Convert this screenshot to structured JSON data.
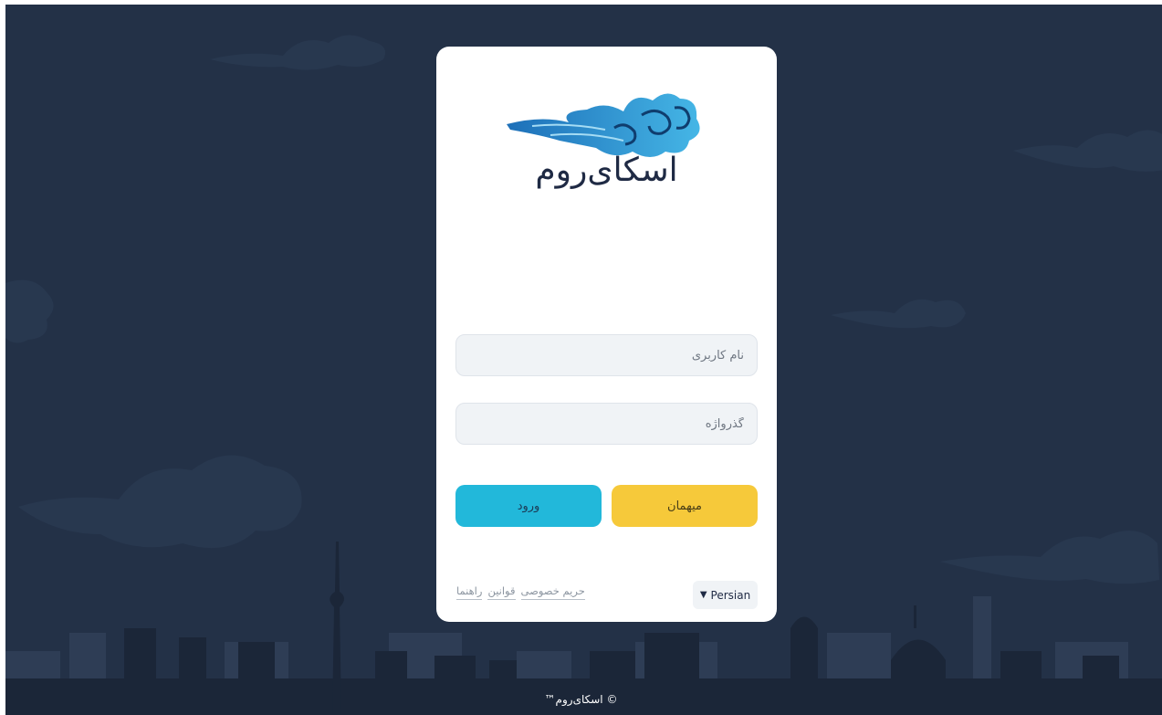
{
  "brand": {
    "name": "اسکای‌روم"
  },
  "login": {
    "username_placeholder": "نام کاربری",
    "password_placeholder": "گذرواژه",
    "login_label": "ورود",
    "guest_label": "میهمان"
  },
  "links": [
    "حریم خصوصی",
    "قوانین",
    "راهنما"
  ],
  "language": {
    "selected": "Persian",
    "icon": "chevron-down-icon"
  },
  "footer": "© اسکای‌روم™",
  "colors": {
    "background": "#233147",
    "login_button": "#22b8da",
    "guest_button": "#f6c93a",
    "card": "#ffffff"
  }
}
